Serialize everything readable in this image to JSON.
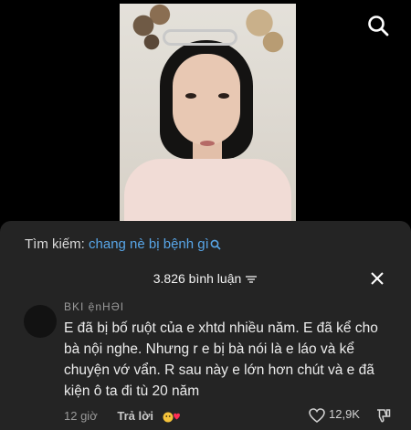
{
  "search": {
    "label": "Tìm kiếm:",
    "query": "chang nè bị bệnh gì"
  },
  "comments_header": {
    "count_text": "3.826 bình luận"
  },
  "comment": {
    "username": "BKI ệnHƏI",
    "text": "E đã bị bố ruột của e xhtd nhiều năm. E đã kể cho bà nội nghe. Nhưng r e bị bà nói là e láo và kể chuyện vớ vẩn. R sau này e lớn hơn chút và e đã kiện ô ta đi tù 20 năm",
    "time": "12 giờ",
    "reply_label": "Trả lời",
    "like_count": "12,9K"
  },
  "colors": {
    "sheet_bg": "#242424",
    "link_blue": "#58a6e8"
  },
  "icons": [
    "search-icon",
    "filter-icon",
    "close-icon",
    "reaction-icon",
    "heart-icon",
    "dislike-icon"
  ]
}
